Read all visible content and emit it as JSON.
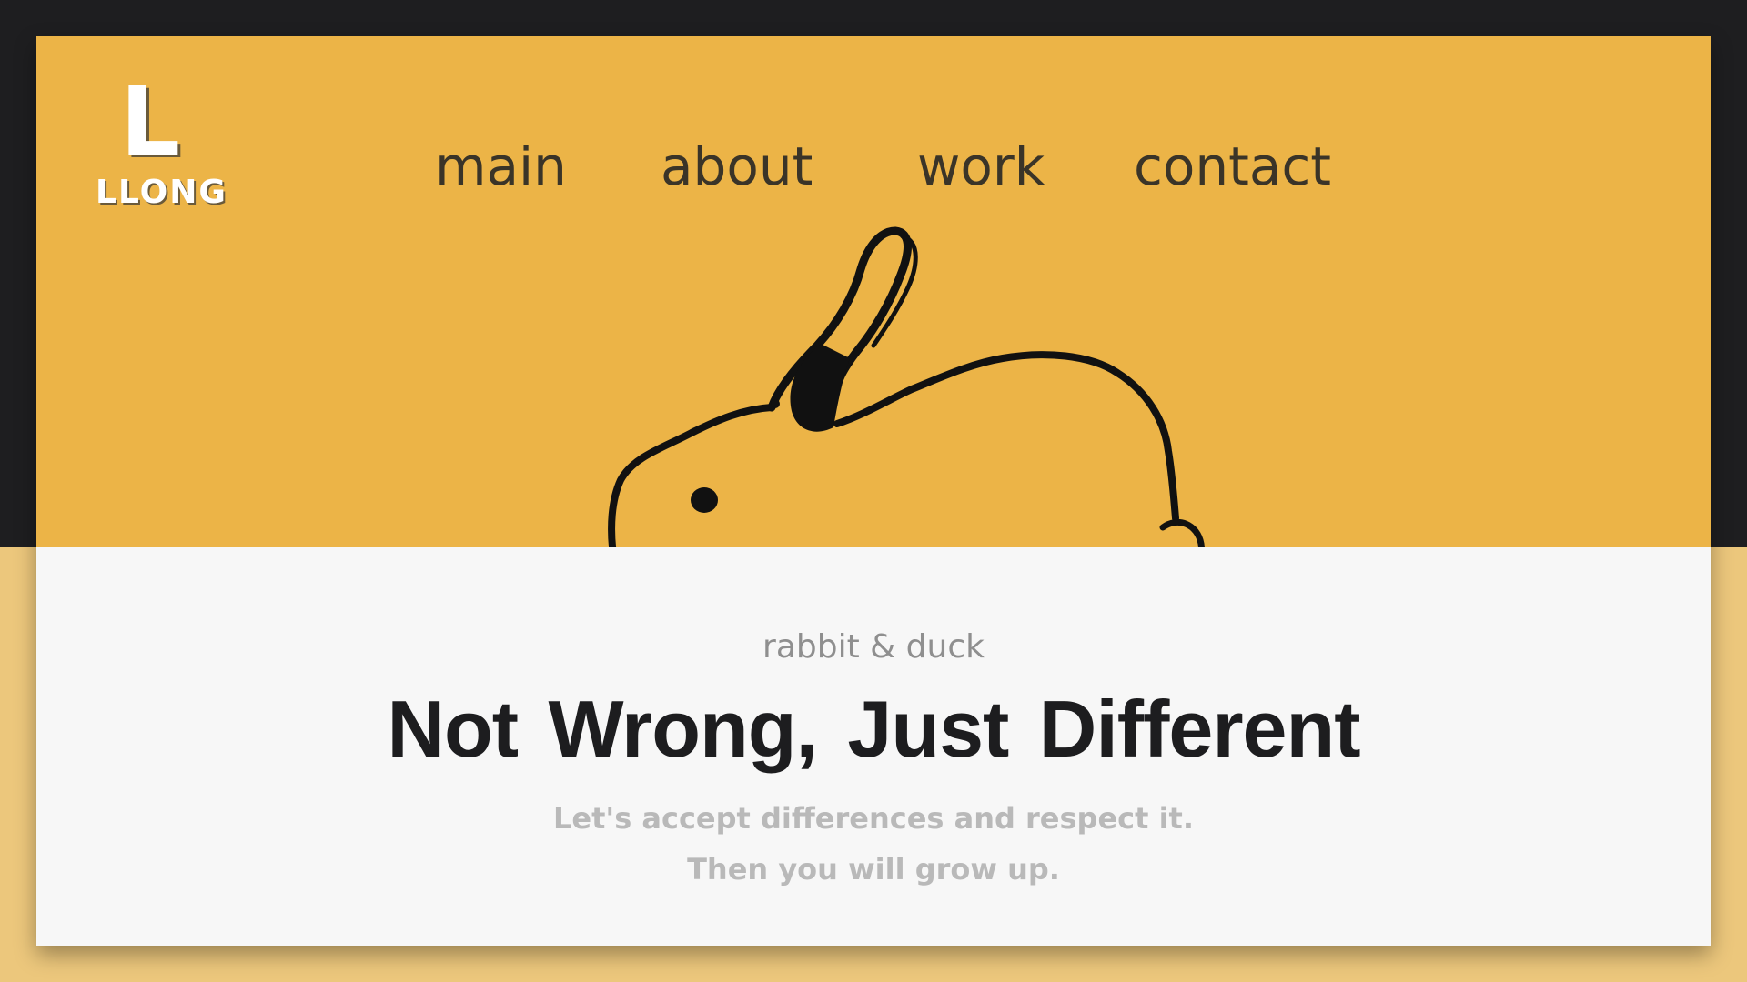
{
  "logo": {
    "letter": "L",
    "word": "LLONG"
  },
  "nav": {
    "items": [
      {
        "label": "main"
      },
      {
        "label": "about"
      },
      {
        "label": "work"
      },
      {
        "label": "contact"
      }
    ]
  },
  "hero": {
    "illustration": "rabbit-duck-illusion"
  },
  "content": {
    "subtitle": "rabbit & duck",
    "headline": "Not Wrong,  Just Different",
    "body_lines": [
      "Let's accept differences and respect it.",
      "Then you will grow up."
    ]
  },
  "colors": {
    "hero_background": "#ecb447",
    "content_background": "#f7f7f7",
    "outer_dark": "#1e1e20",
    "outer_light": "#ecc77c",
    "headline": "#1d1d1f",
    "nav_text": "#3a3428"
  }
}
